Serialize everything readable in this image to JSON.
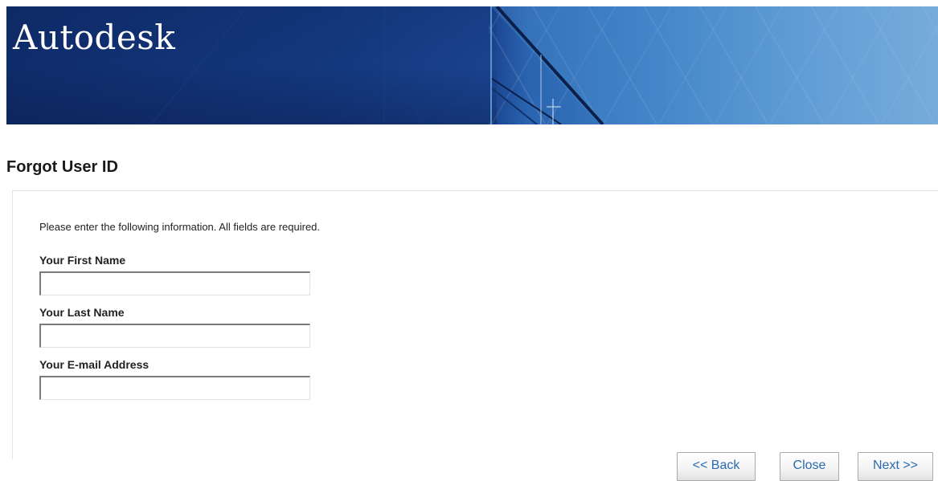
{
  "header": {
    "brand": "Autodesk"
  },
  "page": {
    "title": "Forgot User ID",
    "instructions": "Please enter the following information. All fields are required."
  },
  "form": {
    "fields": [
      {
        "label": "Your First Name",
        "value": "",
        "placeholder": ""
      },
      {
        "label": "Your Last Name",
        "value": "",
        "placeholder": ""
      },
      {
        "label": "Your E-mail Address",
        "value": "",
        "placeholder": ""
      }
    ]
  },
  "buttons": {
    "back": "<< Back",
    "close": "Close",
    "next": "Next >>"
  },
  "colors": {
    "banner_dark": "#14387e",
    "banner_light": "#8cbbe3",
    "button_text": "#2a6bb0"
  }
}
